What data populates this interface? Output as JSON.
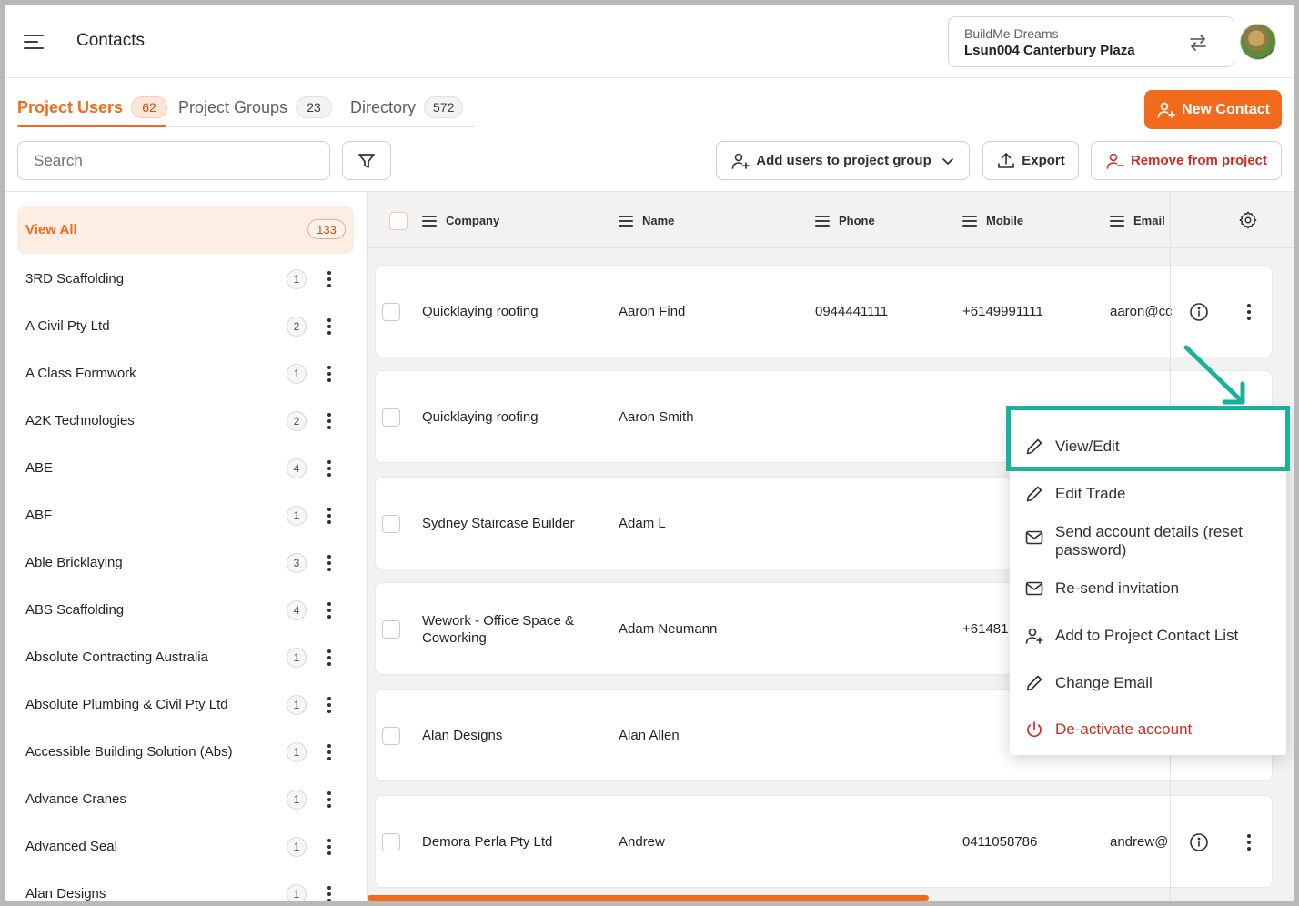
{
  "header": {
    "title": "Contacts",
    "project_org": "BuildMe Dreams",
    "project_name": "Lsun004 Canterbury Plaza"
  },
  "tabs": [
    {
      "label": "Project Users",
      "count": "62",
      "active": true
    },
    {
      "label": "Project Groups",
      "count": "23",
      "active": false
    },
    {
      "label": "Directory",
      "count": "572",
      "active": false
    }
  ],
  "toolbar": {
    "new_contact": "New Contact",
    "search_placeholder": "Search",
    "add_to_group": "Add users to project group",
    "export": "Export",
    "remove": "Remove from project"
  },
  "sidebar": {
    "view_all": {
      "label": "View All",
      "count": "133"
    },
    "items": [
      {
        "label": "3RD Scaffolding",
        "count": "1"
      },
      {
        "label": "A Civil Pty Ltd",
        "count": "2"
      },
      {
        "label": "A Class Formwork",
        "count": "1"
      },
      {
        "label": "A2K Technologies",
        "count": "2"
      },
      {
        "label": "ABE",
        "count": "4"
      },
      {
        "label": "ABF",
        "count": "1"
      },
      {
        "label": "Able Bricklaying",
        "count": "3"
      },
      {
        "label": "ABS Scaffolding",
        "count": "4"
      },
      {
        "label": "Absolute Contracting Australia",
        "count": "1"
      },
      {
        "label": "Absolute Plumbing & Civil Pty Ltd",
        "count": "1"
      },
      {
        "label": "Accessible Building Solution (Abs)",
        "count": "1"
      },
      {
        "label": "Advance Cranes",
        "count": "1"
      },
      {
        "label": "Advanced Seal",
        "count": "1"
      },
      {
        "label": "Alan Designs",
        "count": "1"
      }
    ]
  },
  "table": {
    "columns": [
      "Company",
      "Name",
      "Phone",
      "Mobile",
      "Email"
    ],
    "rows": [
      {
        "company": "Quicklaying roofing",
        "company2": "",
        "name": "Aaron Find",
        "phone": "0944441111",
        "mobile": "+6149991111",
        "email": "aaron@cc"
      },
      {
        "company": "Quicklaying roofing",
        "company2": "",
        "name": "Aaron Smith",
        "phone": "",
        "mobile": "",
        "email": ""
      },
      {
        "company": "Sydney Staircase Builder",
        "company2": "",
        "name": "Adam L",
        "phone": "",
        "mobile": "",
        "email": ""
      },
      {
        "company": "Wework - Office Space &",
        "company2": "Coworking",
        "name": "Adam Neumann",
        "phone": "",
        "mobile": "+61481",
        "email": ""
      },
      {
        "company": "Alan Designs",
        "company2": "",
        "name": "Alan Allen",
        "phone": "",
        "mobile": "",
        "email": ""
      },
      {
        "company": "Demora Perla Pty Ltd",
        "company2": "",
        "name": "Andrew",
        "phone": "",
        "mobile": "0411058786",
        "email": "andrew@"
      }
    ]
  },
  "context_menu": {
    "items": [
      {
        "label": "View/Edit",
        "icon": "pencil-icon"
      },
      {
        "label": "Edit Trade",
        "icon": "pencil-icon"
      },
      {
        "label": "Send account details (reset password)",
        "icon": "mail-icon"
      },
      {
        "label": "Re-send invitation",
        "icon": "mail-icon"
      },
      {
        "label": "Add to Project Contact List",
        "icon": "user-plus-icon"
      },
      {
        "label": "Change Email",
        "icon": "pencil-icon"
      },
      {
        "label": "De-activate account",
        "icon": "power-icon"
      }
    ]
  },
  "colors": {
    "accent": "#f26a1b",
    "danger": "#d02a23",
    "highlight": "#18b39a"
  }
}
